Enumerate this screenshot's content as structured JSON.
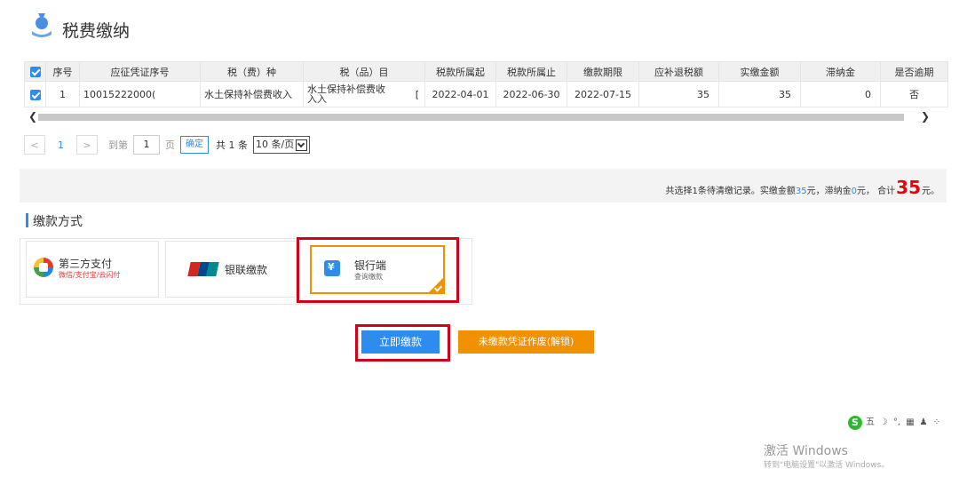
{
  "header": {
    "title": "税费缴纳",
    "icon": "money-bag-hand-icon"
  },
  "table": {
    "columns": [
      "序号",
      "应征凭证序号",
      "税（费）种",
      "税（品）目",
      "税款所属起",
      "税款所属止",
      "缴款期限",
      "应补退税额",
      "实缴金额",
      "滞纳金",
      "是否逾期"
    ],
    "rows": [
      {
        "checked": true,
        "seq": "1",
        "voucher": "10015222000(",
        "tax_type": "水土保持补偿费收入",
        "tax_item": "水土保持补偿费收入入",
        "tax_item_mark": "[",
        "period_start": "2022-04-01",
        "period_end": "2022-06-30",
        "deadline": "2022-07-15",
        "due_amount": "35",
        "paid_amount": "35",
        "late_fee": "0",
        "overdue": "否"
      }
    ]
  },
  "pagination": {
    "prev": "<",
    "current_page": "1",
    "next": ">",
    "goto_label": "到第",
    "goto_value": "1",
    "page_unit": "页",
    "confirm": "确定",
    "total": "共 1 条",
    "page_size": "10 条/页"
  },
  "summary": {
    "prefix": "共选择1条待清缴记录。实缴金额",
    "paid": "35",
    "mid1": " 元，滞纳金 ",
    "late": "0",
    "mid2": "元，  合计",
    "total": "35",
    "suffix": "元。"
  },
  "section": {
    "title": "缴款方式"
  },
  "payment_methods": [
    {
      "title": "第三方支付",
      "subtitle": "微信/支付宝/云闪付",
      "icon": "third-party-pay-icon"
    },
    {
      "title": "银联缴款",
      "logo_top": "UnionPay",
      "logo_bottom": "银联",
      "icon": "unionpay-logo"
    },
    {
      "title": "银行端",
      "subtitle": "查询缴款",
      "icon": "bank-wallet-icon",
      "selected": true
    }
  ],
  "buttons": {
    "pay_now": "立即缴款",
    "void_voucher": "未缴款凭证作废(解锁)"
  },
  "ime": {
    "s": "S",
    "wu": "五",
    "moon": "☽",
    "punct": "°,",
    "kb": "▦",
    "user": "♟",
    "grid": "⁘"
  },
  "watermark": {
    "line1": "激活 Windows",
    "line2": "转到\"电脑设置\"以激活 Windows。"
  },
  "colors": {
    "accent": "#2d8cf0",
    "orange": "#f29100",
    "highlight": "#d0021b"
  }
}
